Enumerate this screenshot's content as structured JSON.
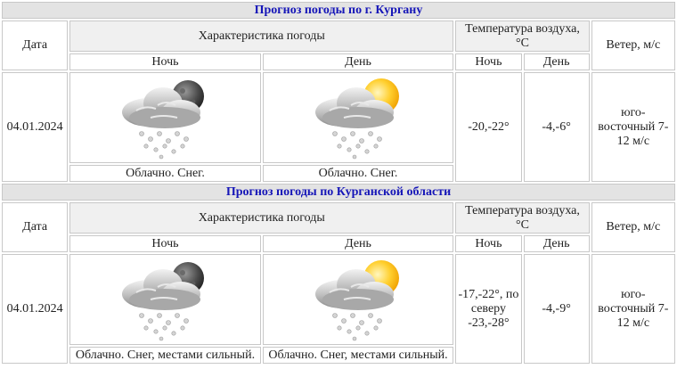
{
  "sections": [
    {
      "title": "Прогноз погоды по г. Кургану",
      "headers": {
        "date": "Дата",
        "characteristic": "Характеристика погоды",
        "temperature": "Температура воздуха, °С",
        "wind": "Ветер, м/с",
        "night": "Ночь",
        "day": "День"
      },
      "row": {
        "date": "04.01.2024",
        "night_icon": "cloud-snow-moon-icon",
        "day_icon": "cloud-snow-sun-icon",
        "night_desc": "Облачно. Снег.",
        "day_desc": "Облачно. Снег.",
        "temp_night": "-20,-22°",
        "temp_day": "-4,-6°",
        "wind": "юго-восточный 7-12 м/с"
      }
    },
    {
      "title": "Прогноз погоды по Курганской области",
      "headers": {
        "date": "Дата",
        "characteristic": "Характеристика погоды",
        "temperature": "Температура воздуха, °С",
        "wind": "Ветер, м/с",
        "night": "Ночь",
        "day": "День"
      },
      "row": {
        "date": "04.01.2024",
        "night_icon": "cloud-snow-moon-icon",
        "day_icon": "cloud-snow-sun-icon",
        "night_desc": "Облачно. Снег, местами сильный.",
        "day_desc": "Облачно. Снег, местами сильный.",
        "temp_night": "-17,-22°, по северу -23,-28°",
        "temp_day": "-4,-9°",
        "wind": "юго-восточный 7-12 м/с"
      }
    }
  ],
  "colors": {
    "title_text": "#1616b8",
    "title_bg": "#e3e3e3",
    "border": "#c8c8c8"
  }
}
